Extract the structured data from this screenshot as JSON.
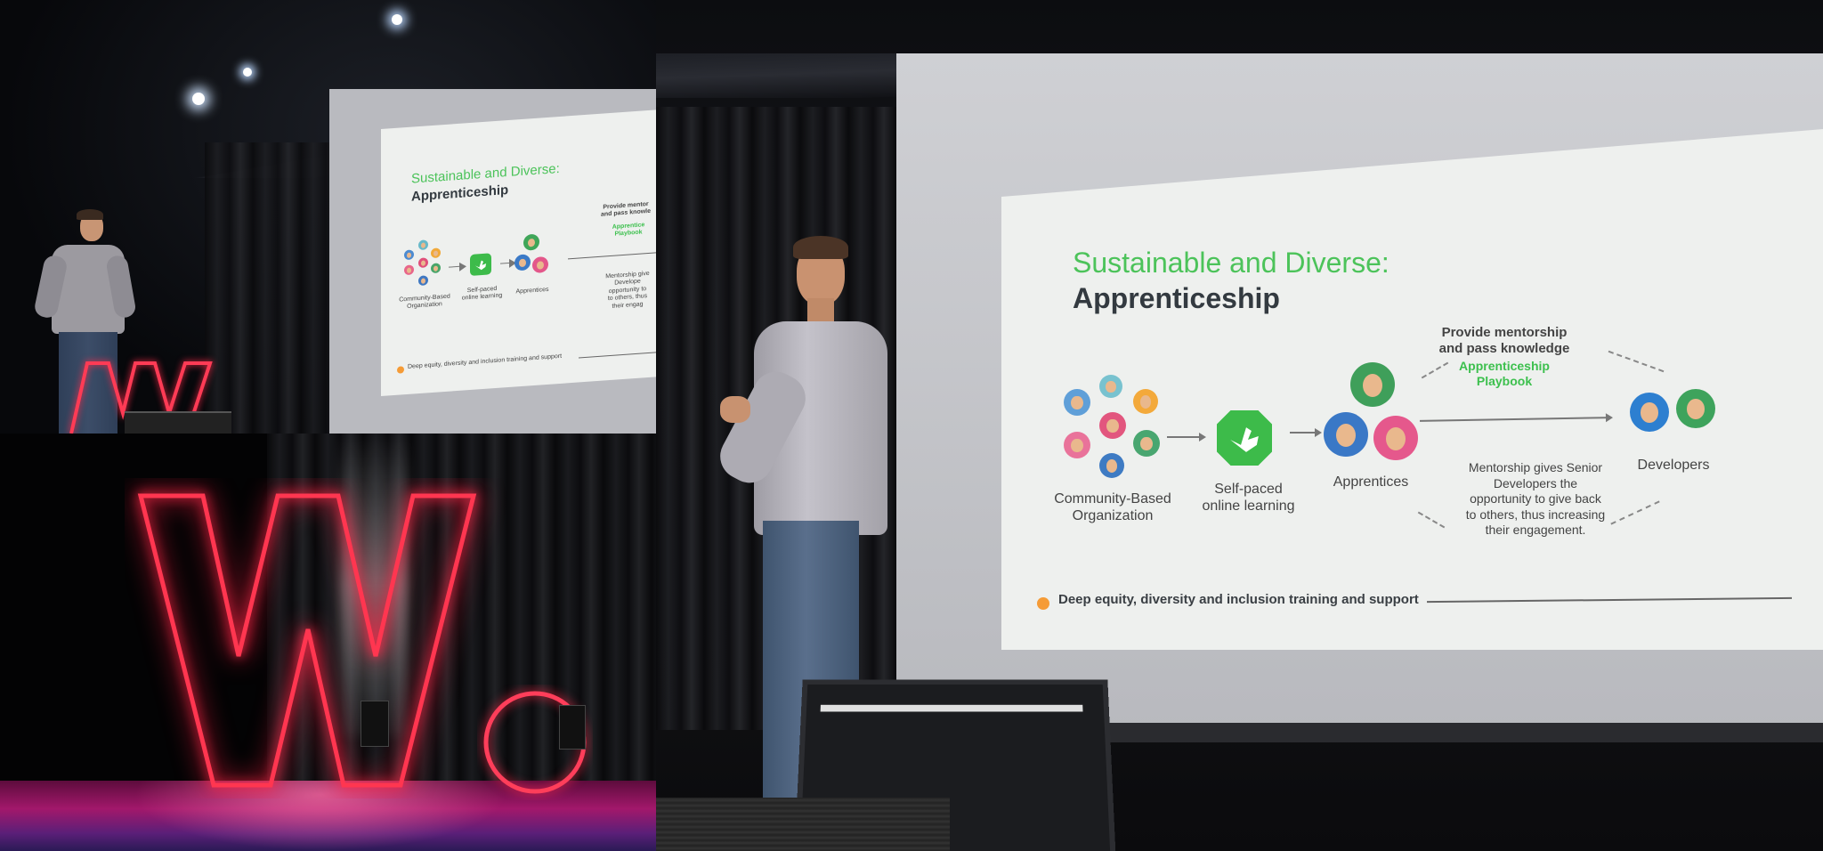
{
  "slide": {
    "title_line1": "Sustainable and Diverse:",
    "title_line2": "Apprenticeship",
    "community_label_1": "Community-Based",
    "community_label_2": "Organization",
    "learning_label_1": "Self-paced",
    "learning_label_2": "online learning",
    "apprentices_label": "Apprentices",
    "developers_label": "Developers",
    "mentorship_top_1": "Provide mentorship",
    "mentorship_top_2": "and pass knowledge",
    "playbook_1": "Apprenticeship",
    "playbook_2": "Playbook",
    "mentorship_bottom_1": "Mentorship gives Senior",
    "mentorship_bottom_2": "Developers the",
    "mentorship_bottom_3": "opportunity to give back",
    "mentorship_bottom_4": "to others, thus increasing",
    "mentorship_bottom_5": "their engagement.",
    "footer": "Deep equity, diversity and inclusion training and support"
  },
  "slide_small": {
    "title_line1": "Sustainable and Diverse:",
    "title_line2": "Apprenticeship",
    "community_label_1": "Community-Based",
    "community_label_2": "Organization",
    "learning_label_1": "Self-paced",
    "learning_label_2": "online learning",
    "apprentices_label": "Apprentices",
    "mentorship_top_1": "Provide mentor",
    "mentorship_top_2": "and pass knowle",
    "playbook_1": "Apprentice",
    "playbook_2": "Playbook",
    "mentorship_bottom_1": "Mentorship give",
    "mentorship_bottom_2": "Develope",
    "mentorship_bottom_3": "opportunity to",
    "mentorship_bottom_4": "to others, thus",
    "mentorship_bottom_5": "their engag",
    "footer": "Deep equity, diversity and inclusion training and support"
  },
  "colors": {
    "accent_green": "#3dc04e",
    "neon_red": "#ff2a4a",
    "slide_bg": "#eef0ee"
  },
  "icons": [
    "neon-w-logo",
    "neon-dot",
    "code-logo-icon",
    "stage-light"
  ]
}
